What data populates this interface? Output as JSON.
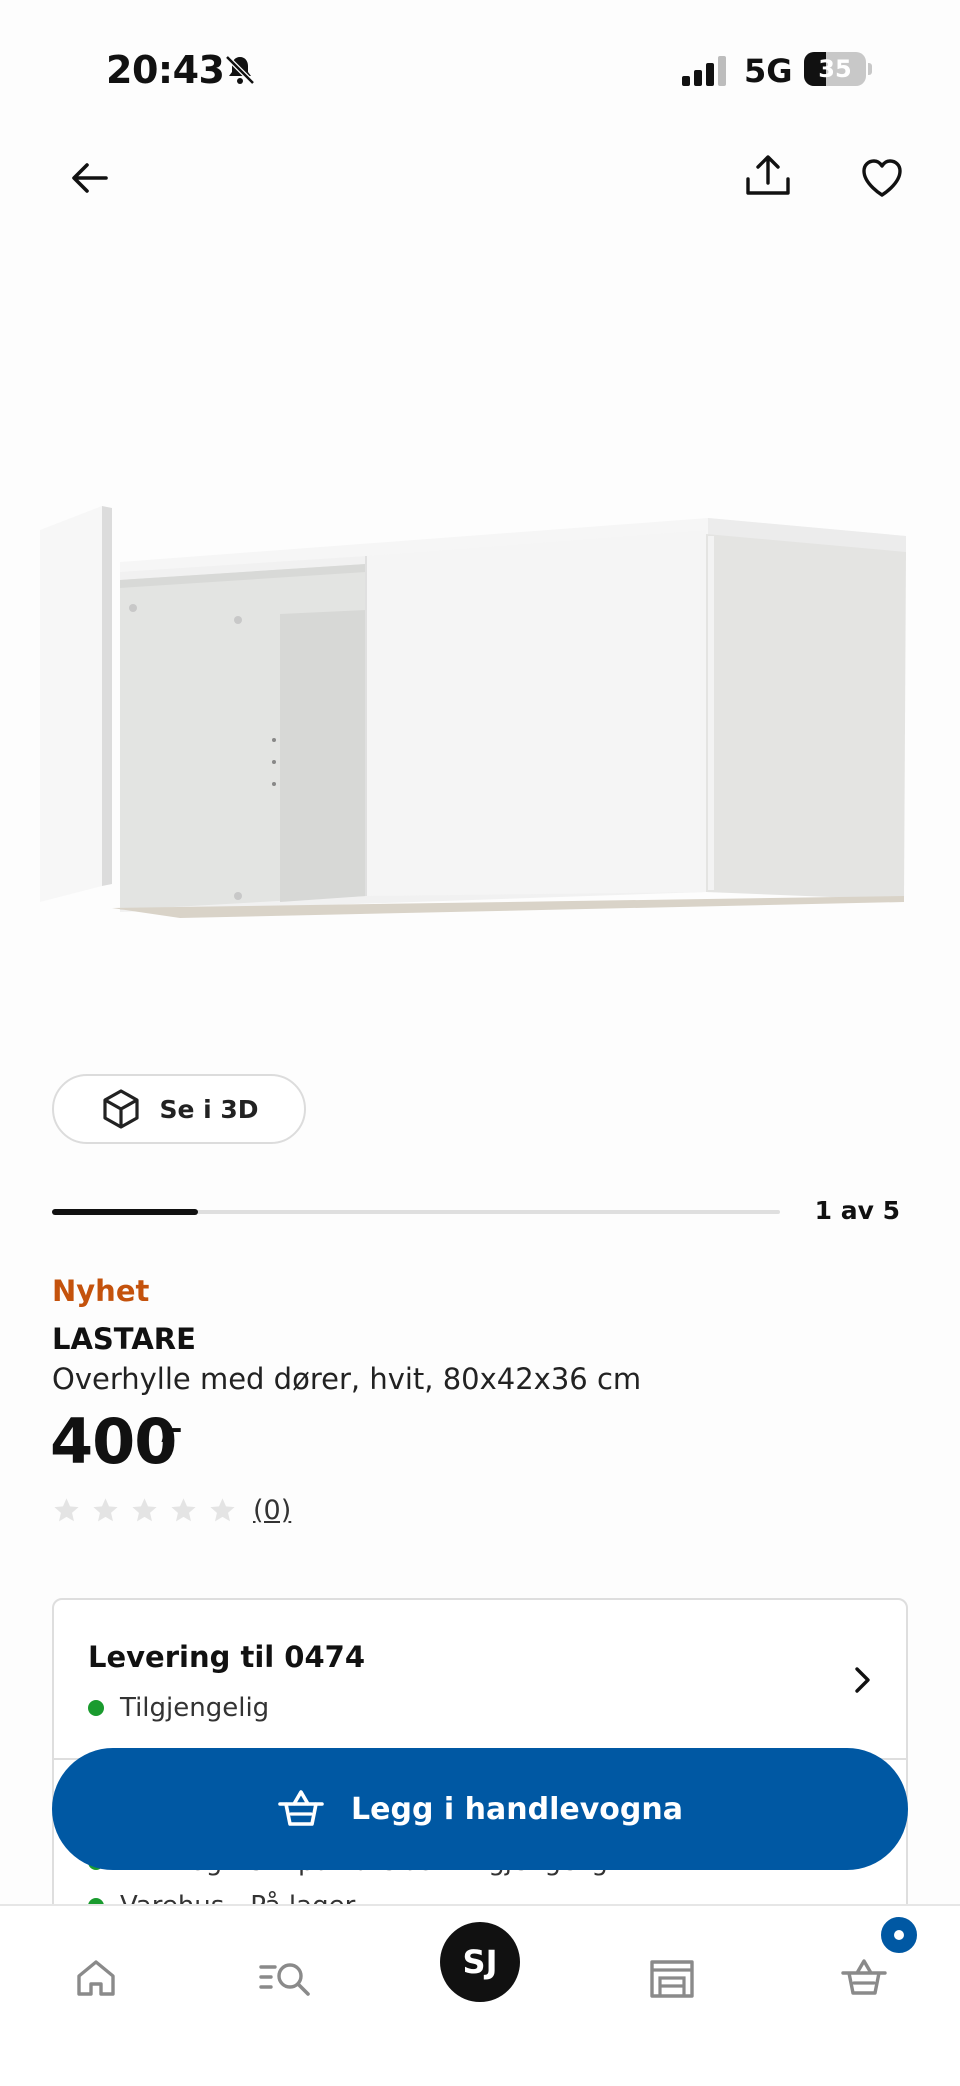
{
  "status_bar": {
    "time": "20:43",
    "network": "5G",
    "battery": "35",
    "battery_level": 0.35
  },
  "icons": {
    "back": "arrow-left-icon",
    "share": "share-icon",
    "favorite": "heart-icon",
    "view_3d": "cube-icon",
    "rating": "star-icon",
    "cart": "basket-icon"
  },
  "product": {
    "image_alt": "LASTARE",
    "view_3d_label": "Se i 3D",
    "carousel_counter": "1 av 5",
    "carousel_progress": 0.2,
    "badge": "Nyhet",
    "name": "LASTARE",
    "description": "Overhylle med dører, hvit, 80x42x36 cm",
    "price": "400",
    "price_suffix": ",-",
    "rating_stars": 0,
    "rating_max": 5,
    "review_count": "(0)"
  },
  "delivery": {
    "title": "Levering til 0474",
    "status": "Tilgjengelig",
    "store_status_partial": "Klikk og hent på varelas - Tilgjengelig",
    "store_stock_partial": "Varehus - På lager"
  },
  "cta": {
    "label": "Legg i handlevogna"
  },
  "bottom_nav": {
    "items": [
      "home-icon",
      "search-icon",
      "profile-avatar",
      "store-icon",
      "cart-icon"
    ],
    "avatar_initials": "SJ"
  },
  "colors": {
    "accent_blue": "#0058a3",
    "new_badge": "#c4520c",
    "available_green": "#1a9b2e"
  }
}
